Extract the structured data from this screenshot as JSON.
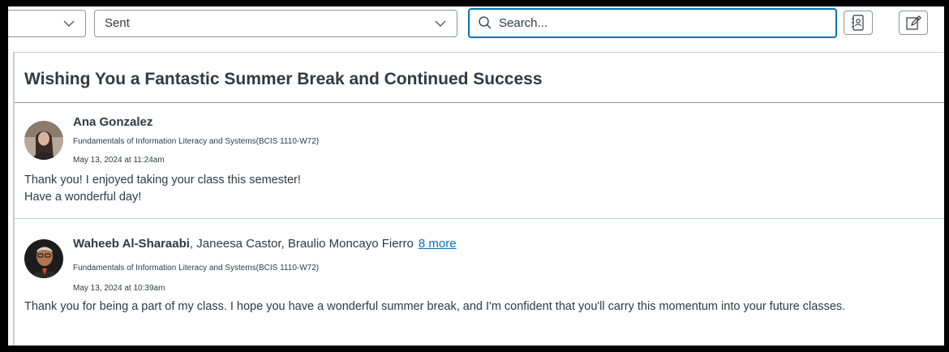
{
  "toolbar": {
    "course_select": {
      "value": ""
    },
    "filter_select": {
      "value": "Sent"
    },
    "search": {
      "placeholder": "Search..."
    },
    "address_book_icon": "address-book-icon",
    "compose_icon": "compose-icon"
  },
  "conversation": {
    "subject": "Wishing You a Fantastic Summer Break and Continued Success",
    "messages": [
      {
        "author": "Ana Gonzalez",
        "other_participants": "",
        "more_link": "",
        "course": "Fundamentals of Information Literacy and Systems(BCIS 1110-W72)",
        "date": "May 13, 2024 at 11:24am",
        "body_lines": [
          "Thank you! I enjoyed taking your class this semester!",
          "Have a wonderful day!"
        ]
      },
      {
        "author": "Waheeb Al-Sharaabi",
        "other_participants": ", Janeesa Castor, Braulio Moncayo Fierro",
        "more_link": "8 more",
        "course": "Fundamentals of Information Literacy and Systems(BCIS 1110-W72)",
        "date": "May 13, 2024 at 10:39am",
        "body_lines": [
          "Thank you for being a part of my class. I hope you have a wonderful summer break, and I'm confident that you'll carry this momentum into your future classes."
        ]
      }
    ]
  }
}
